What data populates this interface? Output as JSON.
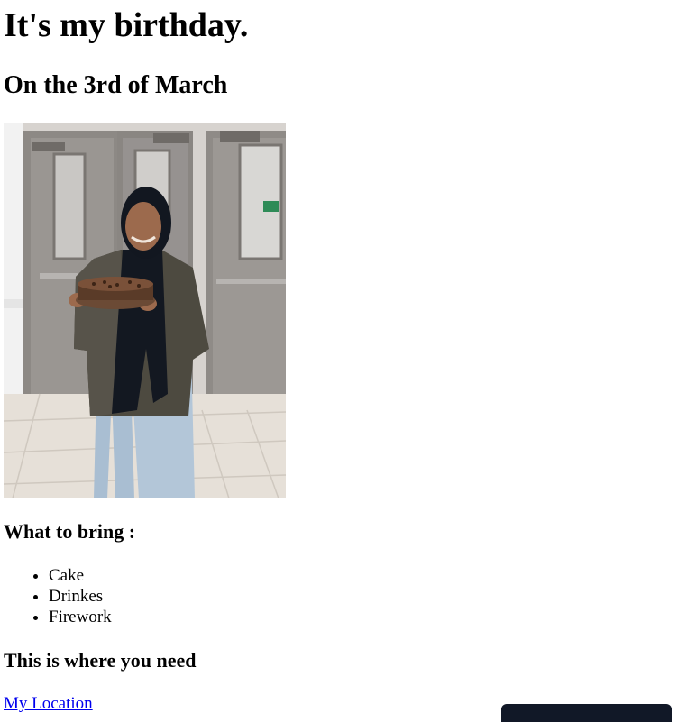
{
  "page": {
    "title": "It's my birthday.",
    "subtitle": "On the 3rd of March"
  },
  "bring": {
    "heading": "What to bring :",
    "items": [
      "Cake",
      "Drinkes",
      "Firework"
    ]
  },
  "location": {
    "heading": "This is where you need",
    "link_label": "My Location"
  },
  "colors": {
    "link": "#0000ee",
    "toast_bg": "#111827"
  }
}
